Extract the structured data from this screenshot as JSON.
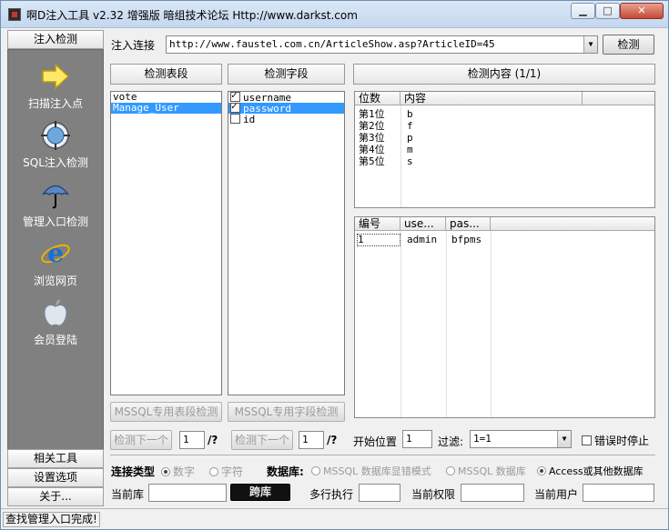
{
  "window": {
    "title": "啊D注入工具 v2.32 增强版 暗组技术论坛 Http://www.darkst.com",
    "min_glyph": "▁",
    "max_glyph": "□",
    "close_glyph": "✕"
  },
  "sidebar": {
    "top_tab": "注入检测",
    "items": [
      {
        "label": "扫描注入点",
        "icon": "arrow-right-icon"
      },
      {
        "label": "SQL注入检测",
        "icon": "globe-target-icon"
      },
      {
        "label": "管理入口检测",
        "icon": "umbrella-icon"
      },
      {
        "label": "浏览网页",
        "icon": "ie-icon"
      },
      {
        "label": "会员登陆",
        "icon": "apple-icon"
      }
    ],
    "bottom_tabs": [
      "相关工具",
      "设置选项",
      "关于..."
    ]
  },
  "url_bar": {
    "label": "注入连接",
    "value": "http://www.faustel.com.cn/ArticleShow.asp?ArticleID=45",
    "detect_button": "检测"
  },
  "tables_panel": {
    "header": "检测表段",
    "items": [
      "vote",
      "Manage_User"
    ],
    "selected_index": 1,
    "button": "MSSQL专用表段检测"
  },
  "fields_panel": {
    "header": "检测字段",
    "items": [
      {
        "name": "username",
        "checked": true
      },
      {
        "name": "password",
        "checked": true
      },
      {
        "name": "id",
        "checked": false
      }
    ],
    "selected_index": 1,
    "button": "MSSQL专用字段检测"
  },
  "content_panel": {
    "header": "检测内容 (1/1)",
    "pos_grid": {
      "columns": [
        "位数",
        "内容"
      ],
      "rows": [
        [
          "第1位",
          "b"
        ],
        [
          "第2位",
          "f"
        ],
        [
          "第3位",
          "p"
        ],
        [
          "第4位",
          "m"
        ],
        [
          "第5位",
          "s"
        ]
      ]
    },
    "result_grid": {
      "columns": [
        "编号",
        "use...",
        "pas..."
      ],
      "rows": [
        [
          "1",
          "admin",
          "bfpms"
        ]
      ]
    }
  },
  "controls_row": {
    "next_button_1": "检测下一个",
    "value_1": "1",
    "q1": "/?",
    "next_button_2": "检测下一个",
    "value_2": "1",
    "q2": "/?",
    "start_label": "开始位置",
    "start_value": "1",
    "filter_label": "过滤:",
    "filter_value": "1=1",
    "stop_on_error": "错误时停止"
  },
  "conn_row": {
    "type_label": "连接类型",
    "opt_number": "数字",
    "opt_char": "字符",
    "db_label": "数据库:",
    "opt_mssql_err": "MSSQL 数据库显错模式",
    "opt_mssql": "MSSQL 数据库",
    "opt_access": "Access或其他数据库"
  },
  "info_row": {
    "current_db_label": "当前库",
    "current_db_value": "",
    "cross_db_button": "跨库",
    "multi_exec_label": "多行执行",
    "multi_exec_value": "",
    "privilege_label": "当前权限",
    "privilege_value": "",
    "user_label": "当前用户",
    "user_value": ""
  },
  "status": {
    "text": "查找管理入口完成!"
  }
}
